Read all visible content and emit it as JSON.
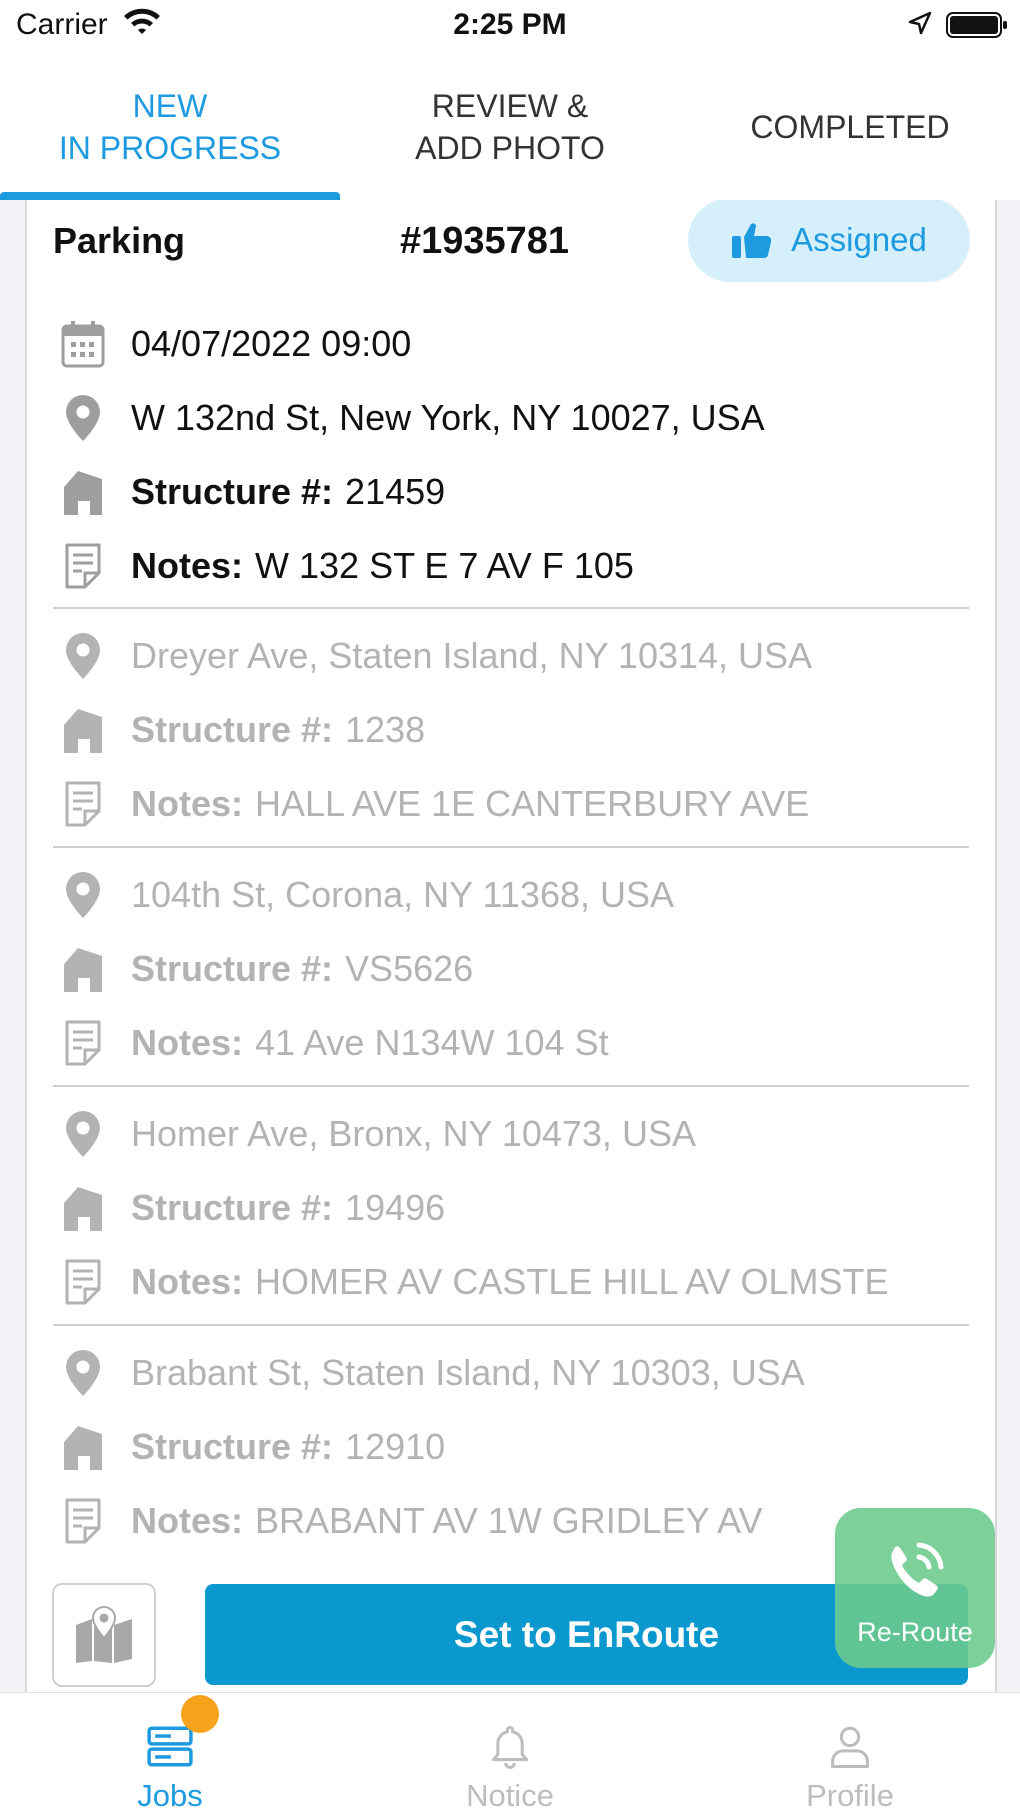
{
  "status_bar": {
    "carrier": "Carrier",
    "time": "2:25 PM"
  },
  "tabs": [
    {
      "label": "NEW\nIN PROGRESS",
      "active": true
    },
    {
      "label": "REVIEW &\nADD PHOTO",
      "active": false
    },
    {
      "label": "COMPLETED",
      "active": false
    }
  ],
  "job": {
    "type": "Parking",
    "number": "#1935781",
    "status": "Assigned",
    "datetime": "04/07/2022 09:00",
    "structure_label": "Structure #:",
    "notes_label": "Notes:",
    "locations": [
      {
        "address": "W 132nd St, New York, NY 10027, USA",
        "structure": "21459",
        "notes": "W 132 ST E 7 AV F 105"
      },
      {
        "address": "Dreyer Ave, Staten Island, NY 10314, USA",
        "structure": "1238",
        "notes": "HALL AVE 1E CANTERBURY AVE"
      },
      {
        "address": "104th St, Corona, NY 11368, USA",
        "structure": "VS5626",
        "notes": "41 Ave N134W 104 St"
      },
      {
        "address": "Homer Ave, Bronx, NY 10473, USA",
        "structure": "19496",
        "notes": "HOMER AV CASTLE HILL AV OLMSTE"
      },
      {
        "address": "Brabant St, Staten Island, NY 10303, USA",
        "structure": "12910",
        "notes": "BRABANT AV 1W GRIDLEY AV"
      }
    ]
  },
  "actions": {
    "enroute": "Set to EnRoute",
    "reroute": "Re-Route"
  },
  "bottom_nav": [
    {
      "label": "Jobs",
      "icon": "jobs-icon",
      "active": true
    },
    {
      "label": "Notice",
      "icon": "bell-icon",
      "active": false
    },
    {
      "label": "Profile",
      "icon": "person-icon",
      "active": false
    }
  ],
  "colors": {
    "accent": "#1e9ae0",
    "primary_button": "#0a98cf",
    "reroute": "#6cc98d",
    "badge_dot": "#f7a21b",
    "muted_text": "#b3b3b3"
  }
}
